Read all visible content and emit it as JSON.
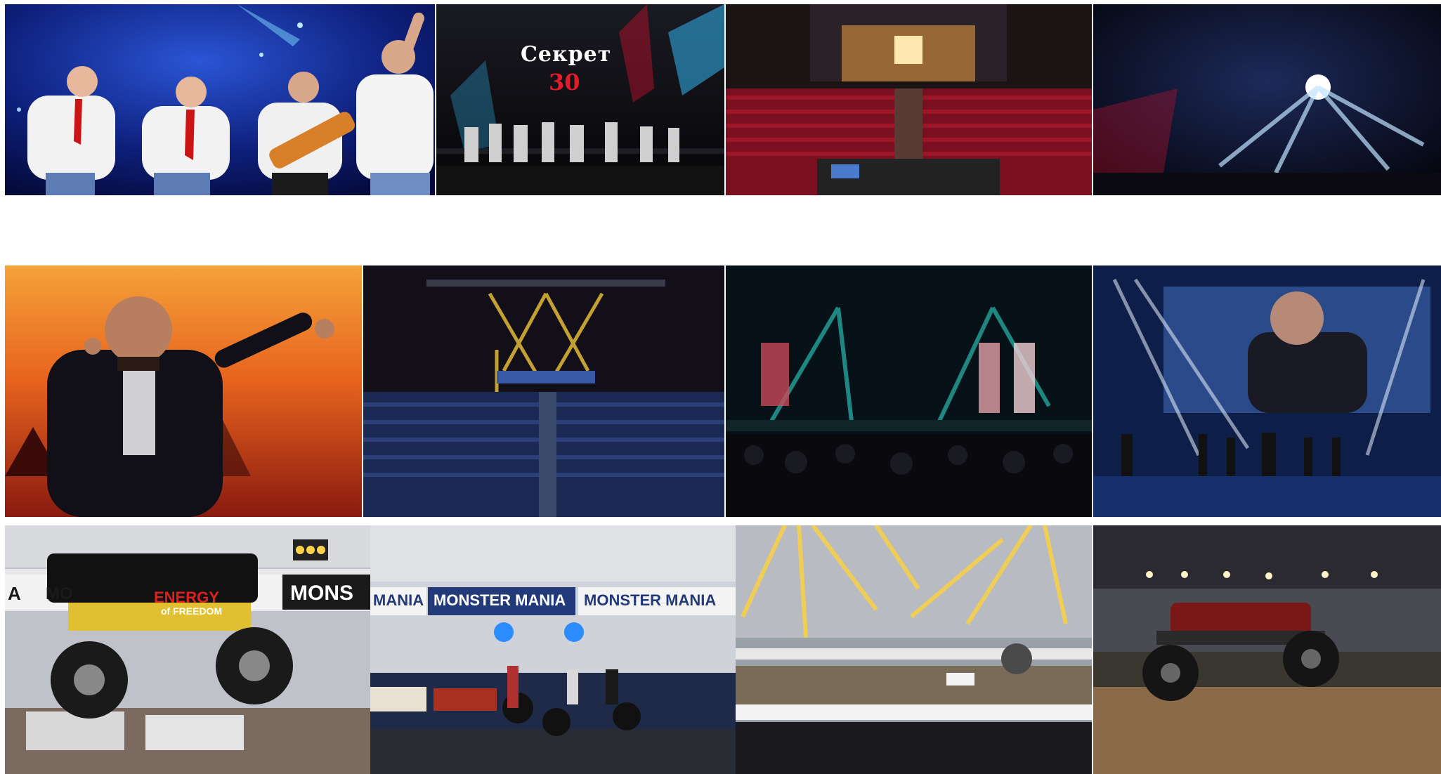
{
  "gallery": {
    "photos": [
      {
        "id": "band-quartet-singing",
        "row": 1,
        "col": 1
      },
      {
        "id": "sekret-30-stage",
        "row": 1,
        "col": 2,
        "stage_title": "Секрет",
        "stage_number": "30"
      },
      {
        "id": "concert-hall-audience-wide",
        "row": 1,
        "col": 3
      },
      {
        "id": "light-show-stage",
        "row": 1,
        "col": 4
      },
      {
        "id": "singer-orange-backdrop",
        "row": 2,
        "col": 1
      },
      {
        "id": "concert-hall-yellow-beams",
        "row": 2,
        "col": 2
      },
      {
        "id": "stage-teal-beams",
        "row": 2,
        "col": 3
      },
      {
        "id": "singer-with-dancers-screen",
        "row": 2,
        "col": 4
      },
      {
        "id": "monster-truck-energy",
        "row": 3,
        "col": 1,
        "truck_logo_line1": "ENERGY",
        "truck_logo_line2": "of FREEDOM",
        "banner_a": "A",
        "banner_mo": "MO",
        "banner_mons": "MONS"
      },
      {
        "id": "motorcycle-stunts",
        "row": 3,
        "col": 2,
        "banner_1": "MANIA",
        "banner_2": "MONSTER MANIA",
        "banner_3": "MONSTER MANIA"
      },
      {
        "id": "arena-yellow-lights",
        "row": 3,
        "col": 3
      },
      {
        "id": "monster-truck-jump",
        "row": 3,
        "col": 4
      }
    ]
  },
  "colors": {
    "background": "#ffffff",
    "stage_blue": "#1a3a9a",
    "stage_red": "#c8102e",
    "beam_yellow": "#ffd23a",
    "beam_teal": "#2fd6c8",
    "sunset_orange": "#e8641e"
  }
}
